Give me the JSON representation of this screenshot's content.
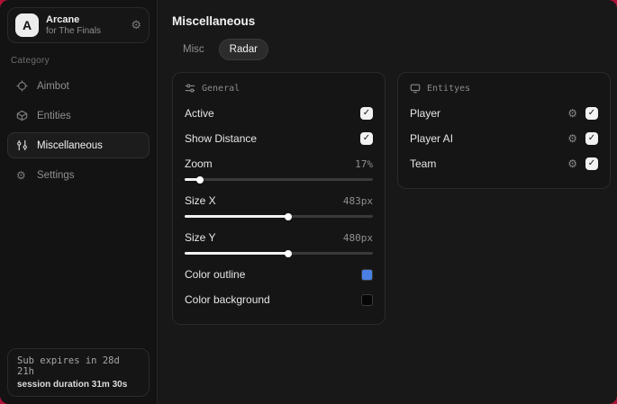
{
  "glyphs": {
    "check": "✓",
    "gear": "⚙"
  },
  "colors": {
    "accent_background": "#b01236",
    "outline_swatch": "#4a80e4",
    "background_swatch": "#060606"
  },
  "sidebar": {
    "logo_letter": "A",
    "app_name": "Arcane",
    "app_subtitle": "for The Finals",
    "category_label": "Category",
    "items": [
      {
        "label": "Aimbot",
        "icon": "crosshair",
        "selected": false
      },
      {
        "label": "Entities",
        "icon": "cube",
        "selected": false
      },
      {
        "label": "Miscellaneous",
        "icon": "sliders",
        "selected": true
      },
      {
        "label": "Settings",
        "icon": "gear",
        "selected": false
      }
    ],
    "sub_expires": "Sub expires in 28d 21h",
    "session_duration": "session duration 31m 30s"
  },
  "main": {
    "title": "Miscellaneous",
    "tabs": [
      {
        "label": "Misc",
        "selected": false
      },
      {
        "label": "Radar",
        "selected": true
      }
    ],
    "general_panel": {
      "title": "General",
      "rows": [
        {
          "type": "checkbox",
          "label": "Active",
          "checked": true
        },
        {
          "type": "checkbox",
          "label": "Show Distance",
          "checked": true
        },
        {
          "type": "slider",
          "label": "Zoom",
          "value": "17%",
          "fill": "8%"
        },
        {
          "type": "slider",
          "label": "Size X",
          "value": "483px",
          "fill": "55%"
        },
        {
          "type": "slider",
          "label": "Size Y",
          "value": "480px",
          "fill": "55%"
        },
        {
          "type": "color",
          "label": "Color outline",
          "color": "#4a80e4"
        },
        {
          "type": "color",
          "label": "Color background",
          "color": "#060606"
        }
      ]
    },
    "entities_panel": {
      "title": "Entityes",
      "rows": [
        {
          "label": "Player",
          "checked": true
        },
        {
          "label": "Player AI",
          "checked": true
        },
        {
          "label": "Team",
          "checked": true
        }
      ]
    }
  }
}
